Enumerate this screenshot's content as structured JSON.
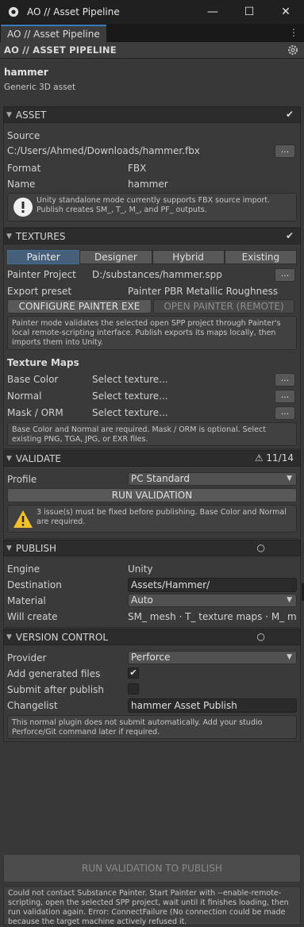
{
  "window": {
    "title": "AO // Asset Pipeline",
    "minimize": "—",
    "maximize": "☐",
    "close": "✕"
  },
  "tab": {
    "label": "AO // Asset Pipeline",
    "menu": "⋮"
  },
  "toolbar": {
    "title": "AO // ASSET PIPELINE"
  },
  "asset": {
    "name": "hammer",
    "description": "Generic 3D asset"
  },
  "asset_section": {
    "title": "ASSET",
    "badge": "✔",
    "source_label": "Source",
    "source_path": "C:/Users/Ahmed/Downloads/hammer.fbx",
    "browse_label": "...",
    "format_label": "Format",
    "format_value": "FBX",
    "name_label": "Name",
    "name_value": "hammer",
    "info": "Unity standalone mode currently supports FBX source import. Publish creates SM_, T_, M_, and PF_ outputs."
  },
  "textures_section": {
    "title": "TEXTURES",
    "badge": "✔",
    "modes": [
      "Painter",
      "Designer",
      "Hybrid",
      "Existing"
    ],
    "active_mode": "Painter",
    "project_label": "Painter Project",
    "project_value": "D:/substances/hammer.spp",
    "browse_label": "...",
    "preset_label": "Export preset",
    "preset_value": "Painter PBR Metallic Roughness",
    "configure_button": "CONFIGURE PAINTER EXE",
    "open_button": "OPEN PAINTER (REMOTE)",
    "help": "Painter mode validates the selected open SPP project through Painter's local remote-scripting interface. Publish exports its maps locally, then imports them into Unity.",
    "maps_title": "Texture Maps",
    "maps": [
      {
        "label": "Base Color",
        "value": "Select texture..."
      },
      {
        "label": "Normal",
        "value": "Select texture..."
      },
      {
        "label": "Mask / ORM",
        "value": "Select texture..."
      }
    ],
    "maps_help": "Base Color and Normal are required. Mask / ORM is optional. Select existing PNG, TGA, JPG, or EXR files."
  },
  "validate_section": {
    "title": "VALIDATE",
    "badge": "⚠ 11/14",
    "profile_label": "Profile",
    "profile_value": "PC Standard",
    "run_button": "RUN VALIDATION",
    "warning": "3 issue(s) must be fixed before publishing. Base Color and Normal are required."
  },
  "publish_section": {
    "title": "PUBLISH",
    "badge": "○",
    "engine_label": "Engine",
    "engine_value": "Unity",
    "destination_label": "Destination",
    "destination_value": "Assets/Hammer/",
    "material_label": "Material",
    "material_value": "Auto",
    "will_create_label": "Will create",
    "will_create_value": "SM_ mesh · T_ texture maps · M_ mate"
  },
  "vcs_section": {
    "title": "VERSION CONTROL",
    "badge": "○",
    "provider_label": "Provider",
    "provider_value": "Perforce",
    "add_files_label": "Add generated files",
    "add_files_checked": true,
    "submit_label": "Submit after publish",
    "submit_checked": false,
    "changelist_label": "Changelist",
    "changelist_value": "hammer Asset Publish",
    "help": "This normal plugin does not submit automatically. Add your studio Perforce/Git command later if required."
  },
  "footer": {
    "publish_button": "RUN VALIDATION TO PUBLISH",
    "error": "Could not contact Substance Painter. Start Painter with --enable-remote-scripting, open the selected SPP project, wait until it finishes loading, then run validation again. Error: ConnectFailure (No connection could be made because the target machine actively refused it."
  },
  "colors": {
    "accent": "#3a79bb",
    "active_tab": "#46607c",
    "warning": "#f2c12e",
    "background": "#383838"
  }
}
